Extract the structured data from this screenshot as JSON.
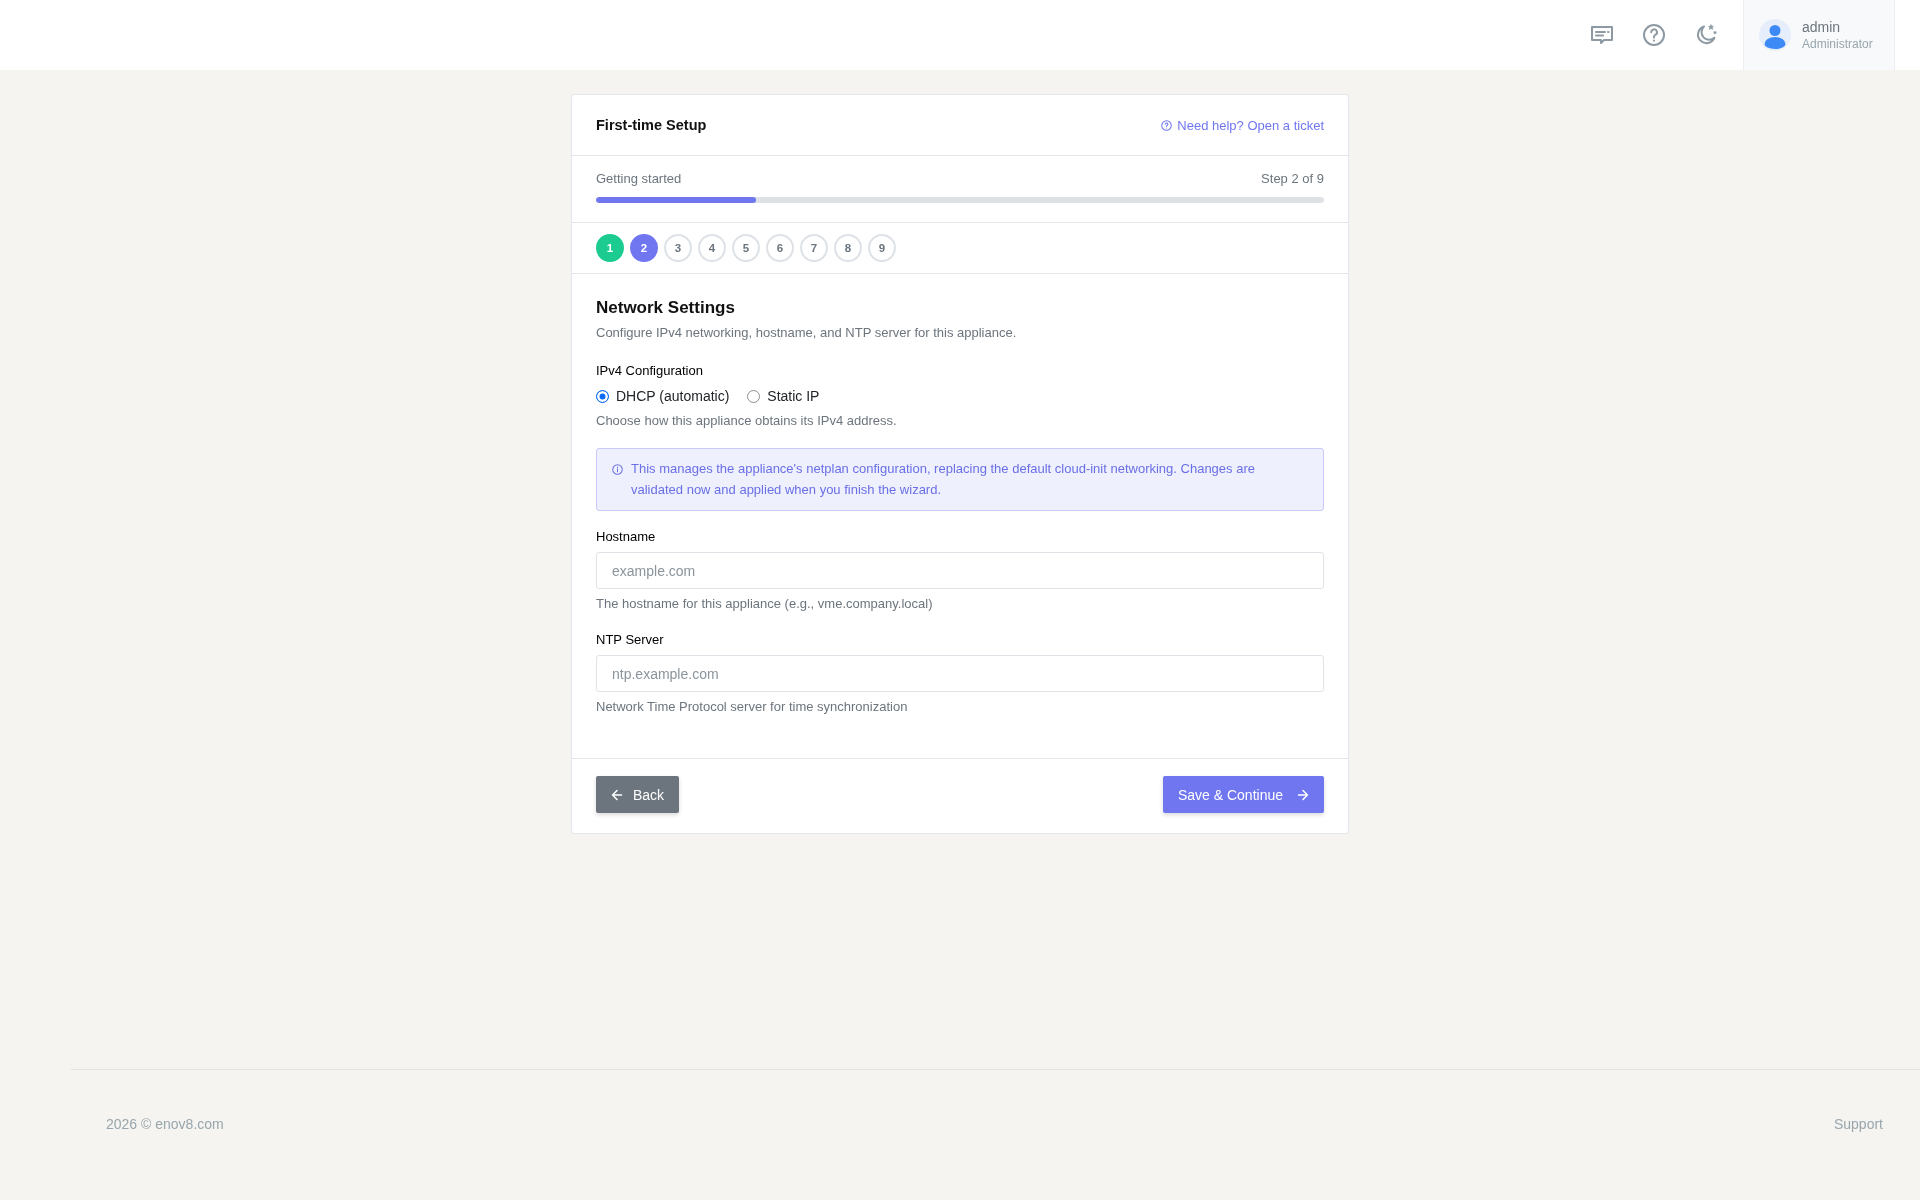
{
  "user": {
    "name": "admin",
    "role": "Administrator"
  },
  "card": {
    "title": "First-time Setup",
    "help_link": "Need help? Open a ticket"
  },
  "progress": {
    "label": "Getting started",
    "step_text": "Step 2 of 9",
    "level": 0.22
  },
  "steps": [
    {
      "label": "1",
      "completed": true,
      "selected": false
    },
    {
      "label": "2",
      "completed": false,
      "selected": true
    },
    {
      "label": "3",
      "completed": false,
      "selected": false
    },
    {
      "label": "4",
      "completed": false,
      "selected": false
    },
    {
      "label": "5",
      "completed": false,
      "selected": false
    },
    {
      "label": "6",
      "completed": false,
      "selected": false
    },
    {
      "label": "7",
      "completed": false,
      "selected": false
    },
    {
      "label": "8",
      "completed": false,
      "selected": false
    },
    {
      "label": "9",
      "completed": false,
      "selected": false
    }
  ],
  "section": {
    "title": "Network Settings",
    "description": "Configure IPv4 networking, hostname, and NTP server for this appliance."
  },
  "ipv4": {
    "label": "IPv4 Configuration",
    "options": [
      {
        "label": "DHCP (automatic)",
        "selected": true
      },
      {
        "label": "Static IP",
        "selected": false
      }
    ],
    "help": "Choose how this appliance obtains its IPv4 address."
  },
  "alert": {
    "text": "This manages the appliance's netplan configuration, replacing the default cloud-init networking. Changes are validated now and applied when you finish the wizard."
  },
  "fields": [
    {
      "label": "Hostname",
      "placeholder": "example.com",
      "help": "The hostname for this appliance (e.g., vme.company.local)"
    },
    {
      "label": "NTP Server",
      "placeholder": "ntp.example.com",
      "help": "Network Time Protocol server for time synchronization"
    }
  ],
  "buttons": [
    {
      "label": "Back",
      "kind": "secondary"
    },
    {
      "label": "Save & Continue",
      "kind": "primary"
    }
  ],
  "footer": {
    "copyright": "2026 © enov8.com",
    "link": "Support"
  }
}
